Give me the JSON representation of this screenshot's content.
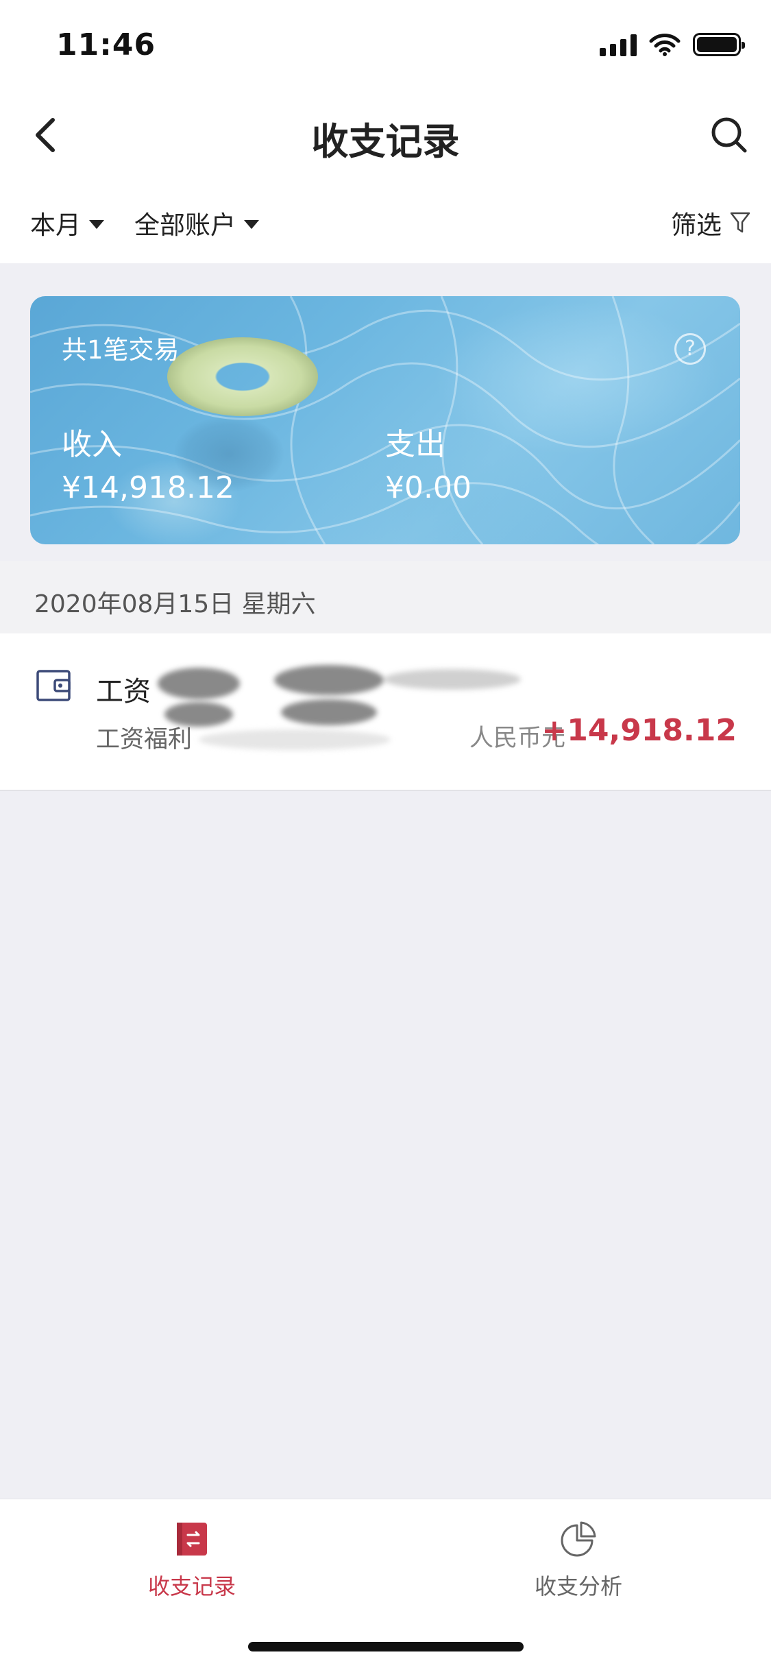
{
  "status_bar": {
    "time": "11:46"
  },
  "nav": {
    "title": "收支记录"
  },
  "filters": {
    "month": "本月",
    "account": "全部账户",
    "filter": "筛选"
  },
  "summary": {
    "transaction_count": "共1笔交易",
    "help": "?",
    "income_label": "收入",
    "income_value": "¥14,918.12",
    "expense_label": "支出",
    "expense_value": "¥0.00"
  },
  "date_group": {
    "date": "2020年08月15日 星期六"
  },
  "transactions": [
    {
      "title": "工资",
      "category": "工资福利",
      "currency": "人民币元",
      "amount": "+14,918.12",
      "icon": "wallet-icon"
    }
  ],
  "tabs": [
    {
      "label": "收支记录",
      "icon": "records-icon",
      "active": true
    },
    {
      "label": "收支分析",
      "icon": "pie-chart-icon",
      "active": false
    }
  ],
  "colors": {
    "accent": "#c8384a",
    "background": "#efeff4",
    "card": "#6bb6e0"
  }
}
